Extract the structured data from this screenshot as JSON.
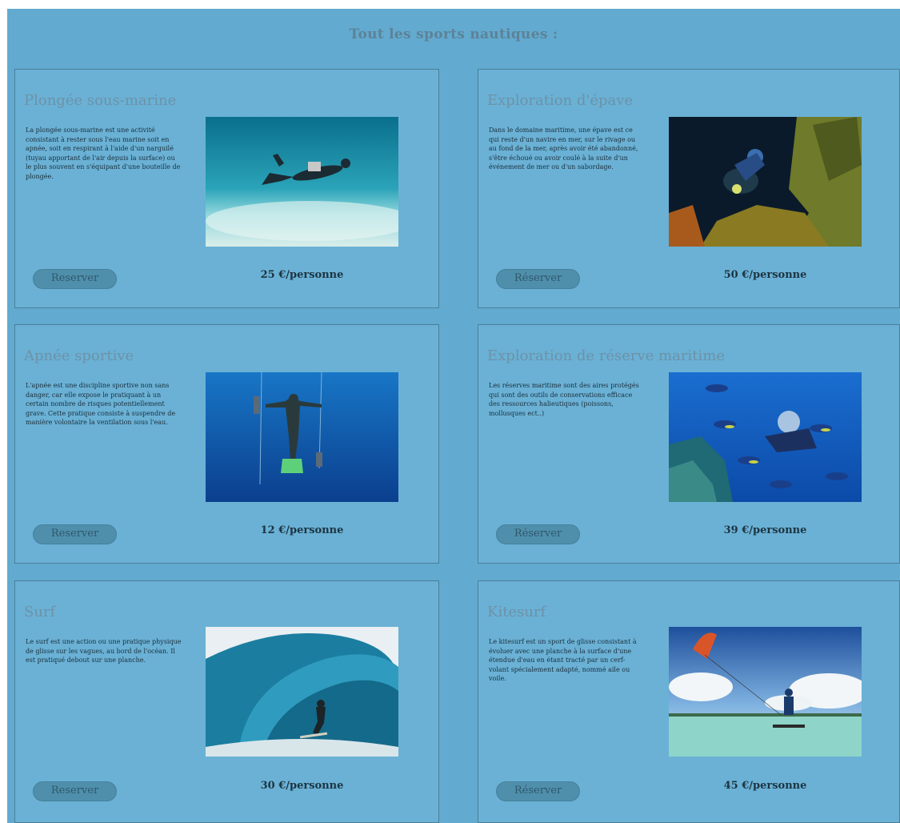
{
  "page": {
    "title": "Tout les sports nautiques :",
    "colors": {
      "background": "#62aacf",
      "card": "#6ab1d5",
      "button": "#4f8fab",
      "title_text": "#6d92a8"
    }
  },
  "cards": [
    {
      "title": "Plongée sous-marine",
      "description": "La plongée sous-marine est une activité consistant à rester sous l'eau marine soit en apnée, soit en respirant à l'aide d'un narguilé (tuyau apportant de l'air depuis la surface) ou le plus souvent en s'équipant d'une bouteille de plongée.",
      "button": "Reserver",
      "price": "25 €/personne",
      "image": "scuba-diver-photo"
    },
    {
      "title": "Exploration d'épave",
      "description": "Dans le domaine maritime, une épave est ce qui reste d'un navire en mer, sur le rivage ou au fond de la mer, après avoir été abandonné, s'être échoué ou avoir coulé à la suite d'un événement de mer ou d'un sabordage.",
      "button": "Réserver",
      "price": "50 €/personne",
      "image": "wreck-diver-photo"
    },
    {
      "title": "Apnée sportive",
      "description": "L'apnée est une discipline sportive non sans danger, car elle expose le pratiquant à un certain nombre de risques potentiellement grave. Cette pratique consiste à suspendre de manière volontaire la ventilation sous l'eau.",
      "button": "Reserver",
      "price": "12 €/personne",
      "image": "freediver-photo"
    },
    {
      "title": "Exploration de réserve maritime",
      "description": "Les réserves maritime sont des aires protégés qui sont des outils de conservations efficace des ressources halieutiques (poissons, mollusques ect..)",
      "button": "Réserver",
      "price": "39 €/personne",
      "image": "reef-fish-photo"
    },
    {
      "title": "Surf",
      "description": "Le surf est une action ou une pratique physique de glisse sur les vagues, au bord de l'océan. Il est pratiqué debout sur une planche.",
      "button": "Reserver",
      "price": "30 €/personne",
      "image": "surfer-wave-photo"
    },
    {
      "title": "Kitesurf",
      "description": "Le kitesurf est un sport de glisse consistant à évoluer avec une planche à la surface d'une étendue d'eau en étant tracté par un cerf-volant spécialement adapté, nommé aile ou voile.",
      "button": "Réserver",
      "price": "45 €/personne",
      "image": "kitesurfer-photo"
    }
  ]
}
